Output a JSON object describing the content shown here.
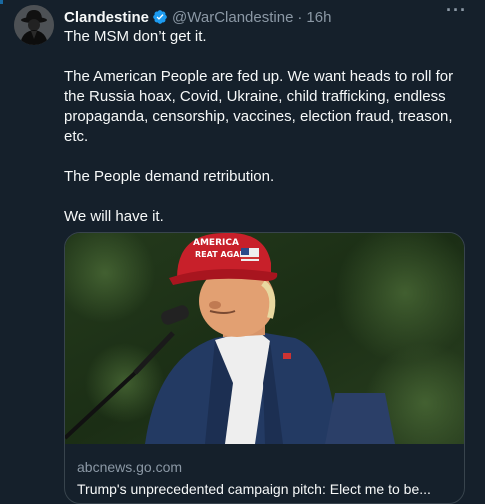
{
  "tweet": {
    "author_name": "Clandestine",
    "handle": "@WarClandestine",
    "separator": "·",
    "time": "16h",
    "more_label": "···",
    "paragraphs": [
      "The MSM don’t get it.",
      "The American People are fed up. We want heads to roll for the Russia hoax, Covid, Ukraine, child trafficking, endless propaganda, censorship, vaccines, election fraud, treason, etc.",
      "The People demand retribution.",
      "We will have it."
    ]
  },
  "card": {
    "domain": "abcnews.go.com",
    "title": "Trump's unprecedented campaign pitch: Elect me to be...",
    "image_alt": "Man in red cap speaking at microphone",
    "hat_text": [
      "AMERICA",
      "REAT AGAIN"
    ]
  },
  "colors": {
    "background": "#15202b",
    "verified_badge": "#1d9bf0",
    "secondary_text": "#8b98a5",
    "card_border": "#38444d"
  },
  "icons": {
    "verified": "verified-badge-icon",
    "more": "more-options-icon"
  }
}
